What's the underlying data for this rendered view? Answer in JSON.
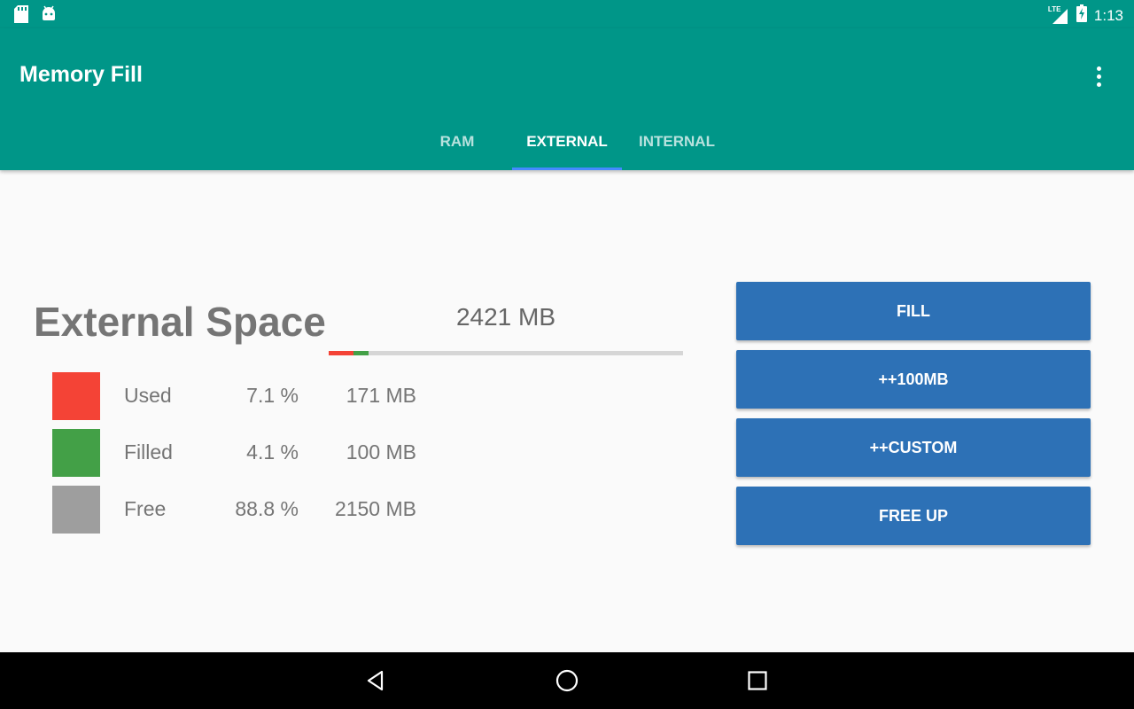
{
  "status_bar": {
    "left_icons": [
      "sd-card-icon",
      "android-icon"
    ],
    "network": "LTE",
    "time": "1:13"
  },
  "app_bar": {
    "title": "Memory Fill",
    "menu_icon": "more-vert-icon"
  },
  "tabs": [
    {
      "label": "RAM",
      "active": false
    },
    {
      "label": "EXTERNAL",
      "active": true
    },
    {
      "label": "INTERNAL",
      "active": false
    }
  ],
  "storage": {
    "title": "External Space",
    "total": "2421 MB",
    "usage_bar": {
      "used_fraction": 0.071,
      "filled_fraction": 0.041
    },
    "legend": [
      {
        "label": "Used",
        "percent": "7.1 %",
        "size": "171 MB",
        "color": "#f44336"
      },
      {
        "label": "Filled",
        "percent": "4.1 %",
        "size": "100 MB",
        "color": "#43a047"
      },
      {
        "label": "Free",
        "percent": "88.8 %",
        "size": "2150 MB",
        "color": "#9e9e9e"
      }
    ]
  },
  "actions": {
    "fill": "FILL",
    "add_100mb": "++100MB",
    "add_custom": "++CUSTOM",
    "free_up": "FREE UP"
  },
  "colors": {
    "primary": "#009688",
    "tab_indicator": "#448aff",
    "button": "#2d71b6",
    "used": "#f44336",
    "filled": "#43a047",
    "free": "#9e9e9e"
  },
  "nav_bar": {
    "back_icon": "back-triangle-icon",
    "home_icon": "home-circle-icon",
    "recents_icon": "recents-square-icon"
  }
}
